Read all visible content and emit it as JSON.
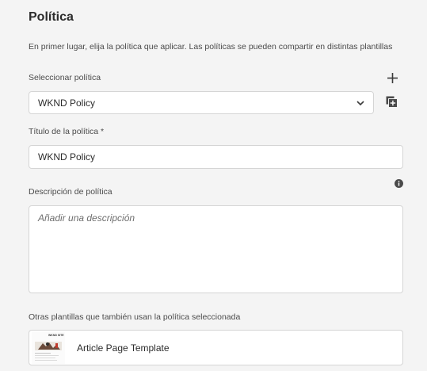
{
  "panel": {
    "title": "Política",
    "description": "En primer lugar, elija la política que aplicar. Las políticas se pueden compartir en distintas plantillas"
  },
  "policy_select": {
    "label": "Seleccionar política",
    "value": "WKND Policy",
    "add_icon": "plus-icon",
    "copy_icon": "duplicate-icon"
  },
  "policy_title": {
    "label": "Título de la política *",
    "value": "WKND Policy"
  },
  "policy_description": {
    "label": "Descripción de política",
    "placeholder": "Añadir una descripción",
    "info_icon": "info-icon"
  },
  "other_templates": {
    "label": "Otras plantillas que también usan la política seleccionada",
    "items": [
      {
        "name": "Article Page Template",
        "thumb_caption": "WKND SITE"
      }
    ]
  },
  "colors": {
    "background": "#f4f4f4",
    "field_border": "#d5d5d5",
    "text": "#2c2c2c"
  }
}
